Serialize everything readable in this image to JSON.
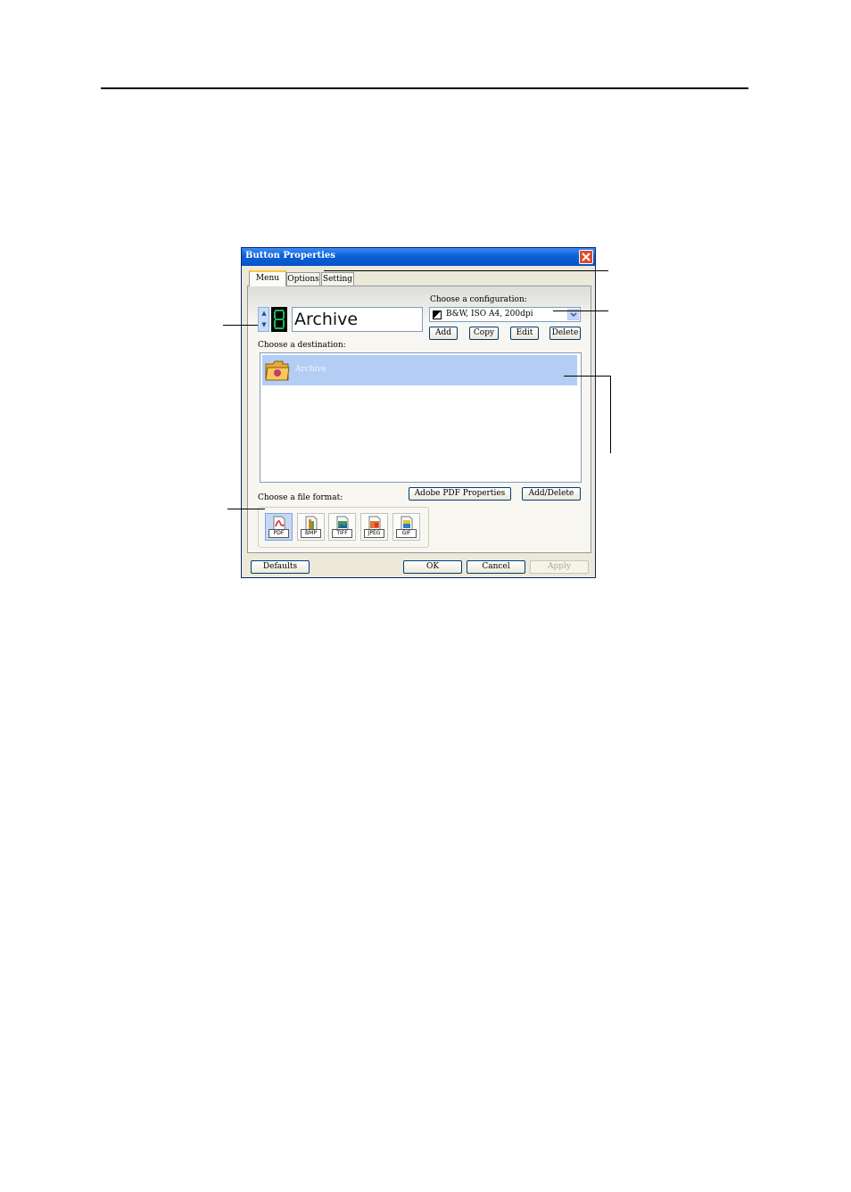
{
  "dialog": {
    "title": "Button Properties",
    "tabs": [
      {
        "label": "Menu"
      },
      {
        "label": "Options"
      },
      {
        "label": "Setting"
      }
    ],
    "button_name": "Archive",
    "configuration": {
      "label": "Choose a configuration:",
      "selected": "B&W, ISO A4, 200dpi",
      "buttons": {
        "add": "Add",
        "copy": "Copy",
        "edit": "Edit",
        "delete": "Delete"
      }
    },
    "destination": {
      "label": "Choose a destination:",
      "items": [
        {
          "name": "Archive"
        }
      ]
    },
    "file_format": {
      "label": "Choose a file format:",
      "formats": [
        "PDF",
        "BMP",
        "TIFF",
        "JPEG",
        "GIF"
      ],
      "selected": "PDF"
    },
    "actions": {
      "adobe_pdf_properties": "Adobe PDF Properties",
      "add_delete": "Add/Delete"
    },
    "footer": {
      "defaults": "Defaults",
      "ok": "OK",
      "cancel": "Cancel",
      "apply": "Apply"
    }
  }
}
